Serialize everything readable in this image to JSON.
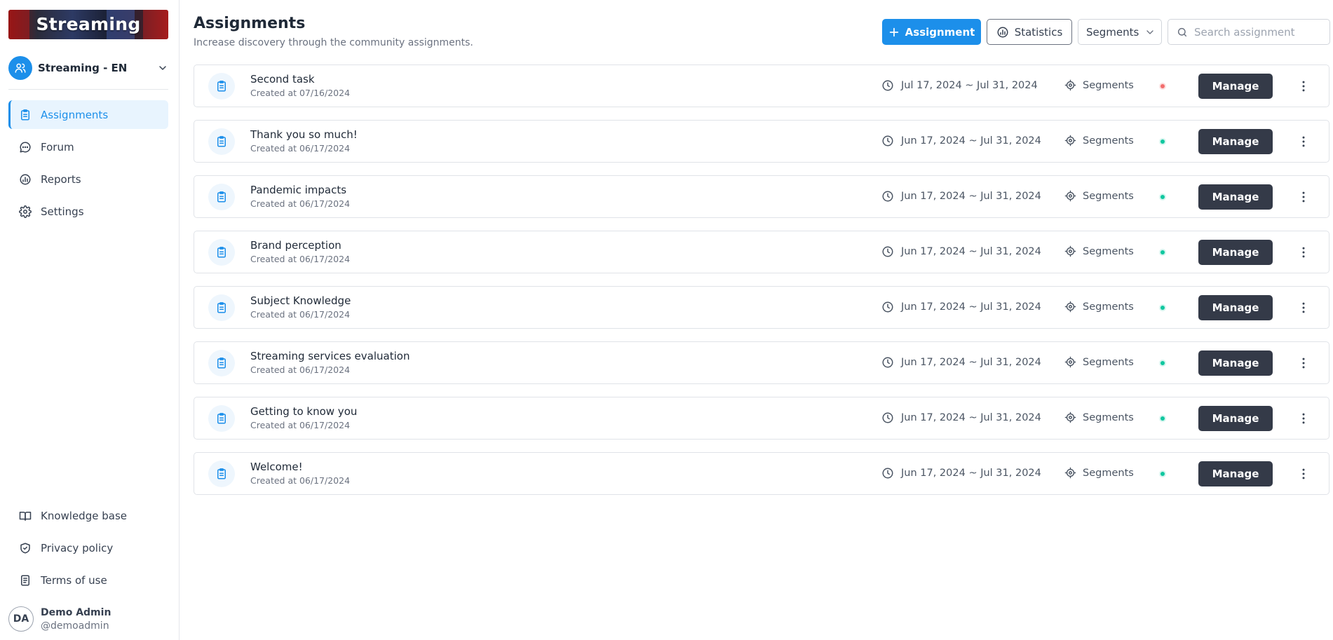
{
  "brand": {
    "name": "Streaming"
  },
  "community": {
    "name": "Streaming - EN"
  },
  "nav": {
    "items": [
      {
        "label": "Assignments",
        "icon": "clipboard-icon",
        "active": true
      },
      {
        "label": "Forum",
        "icon": "chat-bubble-icon",
        "active": false
      },
      {
        "label": "Reports",
        "icon": "chart-icon",
        "active": false
      },
      {
        "label": "Settings",
        "icon": "gear-icon",
        "active": false
      }
    ]
  },
  "bottom_nav": {
    "items": [
      {
        "label": "Knowledge base",
        "icon": "book-icon"
      },
      {
        "label": "Privacy policy",
        "icon": "shield-check-icon"
      },
      {
        "label": "Terms of use",
        "icon": "document-icon"
      }
    ]
  },
  "user": {
    "initials": "DA",
    "name": "Demo Admin",
    "handle": "@demoadmin"
  },
  "header": {
    "title": "Assignments",
    "subtitle": "Increase discovery through the community assignments."
  },
  "toolbar": {
    "add_label": "Assignment",
    "statistics_label": "Statistics",
    "segments_label": "Segments",
    "search_placeholder": "Search assignment"
  },
  "colors": {
    "accent": "#1c8fea",
    "status_active": "#10c79f",
    "status_inactive": "#f26d6d",
    "manage_button": "#343a48"
  },
  "assignments": [
    {
      "title": "Second task",
      "created": "Created at 07/16/2024",
      "dates": "Jul 17, 2024 ~ Jul 31, 2024",
      "segments": "Segments",
      "status": "inactive",
      "manage": "Manage"
    },
    {
      "title": "Thank you so much!",
      "created": "Created at 06/17/2024",
      "dates": "Jun 17, 2024 ~ Jul 31, 2024",
      "segments": "Segments",
      "status": "active",
      "manage": "Manage"
    },
    {
      "title": "Pandemic impacts",
      "created": "Created at 06/17/2024",
      "dates": "Jun 17, 2024 ~ Jul 31, 2024",
      "segments": "Segments",
      "status": "active",
      "manage": "Manage"
    },
    {
      "title": "Brand perception",
      "created": "Created at 06/17/2024",
      "dates": "Jun 17, 2024 ~ Jul 31, 2024",
      "segments": "Segments",
      "status": "active",
      "manage": "Manage"
    },
    {
      "title": "Subject Knowledge",
      "created": "Created at 06/17/2024",
      "dates": "Jun 17, 2024 ~ Jul 31, 2024",
      "segments": "Segments",
      "status": "active",
      "manage": "Manage"
    },
    {
      "title": "Streaming services evaluation",
      "created": "Created at 06/17/2024",
      "dates": "Jun 17, 2024 ~ Jul 31, 2024",
      "segments": "Segments",
      "status": "active",
      "manage": "Manage"
    },
    {
      "title": "Getting to know you",
      "created": "Created at 06/17/2024",
      "dates": "Jun 17, 2024 ~ Jul 31, 2024",
      "segments": "Segments",
      "status": "active",
      "manage": "Manage"
    },
    {
      "title": "Welcome!",
      "created": "Created at 06/17/2024",
      "dates": "Jun 17, 2024 ~ Jul 31, 2024",
      "segments": "Segments",
      "status": "active",
      "manage": "Manage"
    }
  ]
}
